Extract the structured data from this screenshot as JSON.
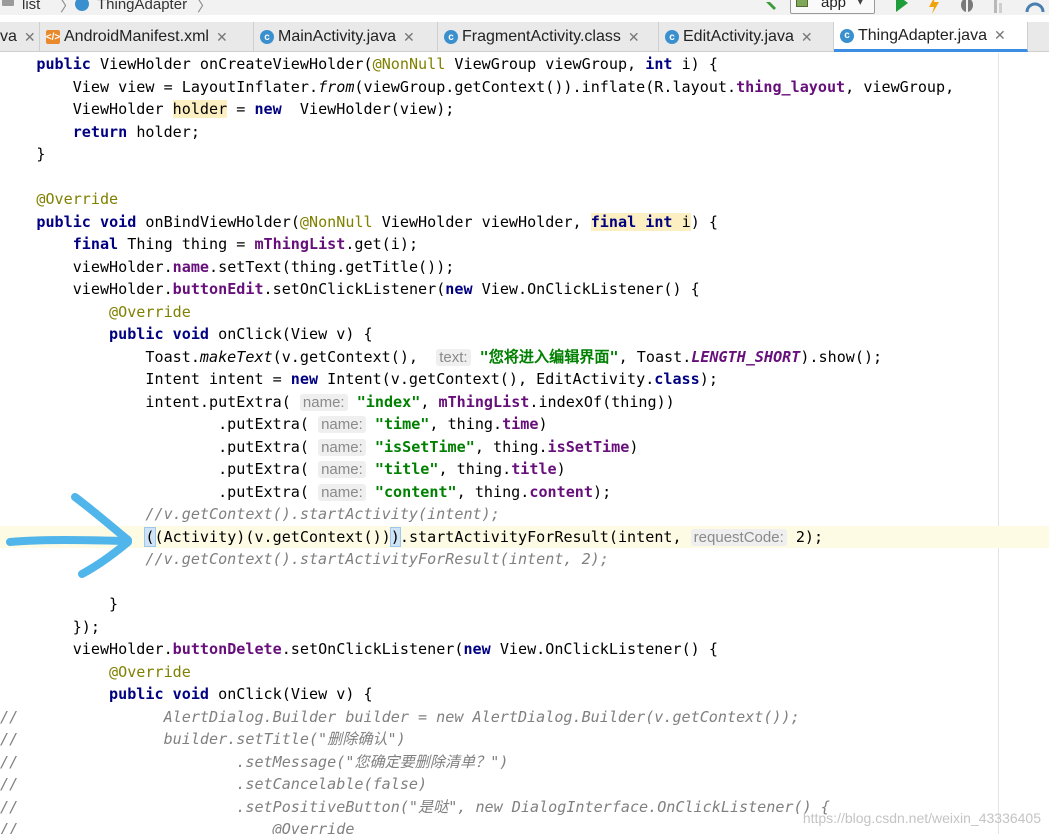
{
  "breadcrumb": {
    "folder": "list",
    "file": "ThingAdapter"
  },
  "toolbar": {
    "run_config": "app"
  },
  "tabs": [
    {
      "label": "va",
      "icon": "class-icon",
      "active": false
    },
    {
      "label": "AndroidManifest.xml",
      "icon": "xml-file-icon",
      "active": false
    },
    {
      "label": "MainActivity.java",
      "icon": "class-icon",
      "active": false
    },
    {
      "label": "FragmentActivity.class",
      "icon": "compiled-class-icon",
      "active": false
    },
    {
      "label": "EditActivity.java",
      "icon": "class-icon",
      "active": false
    },
    {
      "label": "ThingAdapter.java",
      "icon": "class-icon",
      "active": true
    }
  ],
  "code": [
    "    public ViewHolder onCreateViewHolder(@NonNull ViewGroup viewGroup, int i) {",
    "        View view = LayoutInflater.from(viewGroup.getContext()).inflate(R.layout.thing_layout, viewGroup,",
    "        ViewHolder holder = new  ViewHolder(view);",
    "        return holder;",
    "    }",
    "",
    "    @Override",
    "    public void onBindViewHolder(@NonNull ViewHolder viewHolder, final int i) {",
    "        final Thing thing = mThingList.get(i);",
    "        viewHolder.name.setText(thing.getTitle());",
    "        viewHolder.buttonEdit.setOnClickListener(new View.OnClickListener() {",
    "            @Override",
    "            public void onClick(View v) {",
    "                Toast.makeText(v.getContext(),  text: \"您将进入编辑界面\", Toast.LENGTH_SHORT).show();",
    "                Intent intent = new Intent(v.getContext(), EditActivity.class);",
    "                intent.putExtra( name: \"index\", mThingList.indexOf(thing))",
    "                        .putExtra( name: \"time\", thing.time)",
    "                        .putExtra( name: \"isSetTime\", thing.isSetTime)",
    "                        .putExtra( name: \"title\", thing.title)",
    "                        .putExtra( name: \"content\", thing.content);",
    "                //v.getContext().startActivity(intent);",
    "                ((Activity)(v.getContext())).startActivityForResult(intent, requestCode: 2);",
    "                //v.getContext().startActivityForResult(intent, 2);",
    "",
    "            }",
    "        });",
    "        viewHolder.buttonDelete.setOnClickListener(new View.OnClickListener() {",
    "            @Override",
    "            public void onClick(View v) {",
    "//                AlertDialog.Builder builder = new AlertDialog.Builder(v.getContext());",
    "//                builder.setTitle(\"删除确认\")",
    "//                        .setMessage(\"您确定要删除清单？\")",
    "//                        .setCancelable(false)",
    "//                        .setPositiveButton(\"是哒\", new DialogInterface.OnClickListener() {",
    "//                            @Override"
  ],
  "watermark": "https://blog.csdn.net/weixin_43336405",
  "colors": {
    "keyword": "#000080",
    "annotation": "#808000",
    "field": "#660e7a",
    "string": "#008000",
    "comment": "#808080",
    "arrow": "#4fb5ea",
    "tab_active": "#3c8ee2"
  }
}
